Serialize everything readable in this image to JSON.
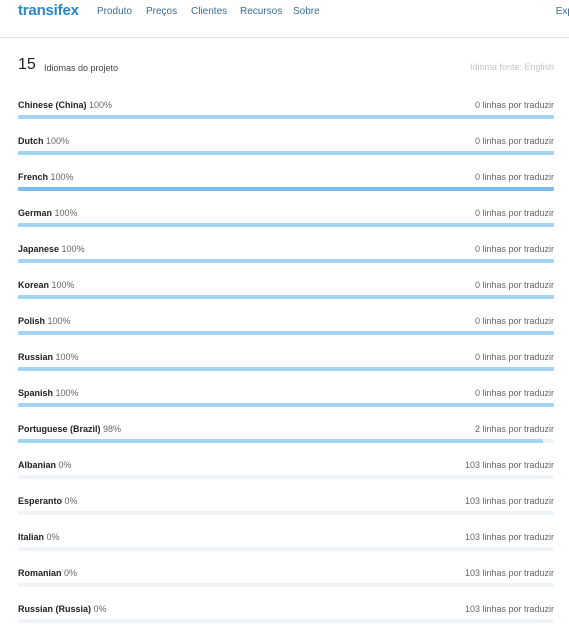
{
  "header": {
    "logo": "transifex",
    "nav": [
      "Produto",
      "Preços",
      "Clientes",
      "Recursos",
      "Sobre"
    ],
    "right_link": "Exp"
  },
  "summary": {
    "count": "15",
    "count_label": "Idiomas do projeto",
    "source_language": "Idioma fonte: English"
  },
  "languages": [
    {
      "name": "Chinese (China)",
      "percent": "100%",
      "progress": 100,
      "remaining": "0 linhas por traduzir"
    },
    {
      "name": "Dutch",
      "percent": "100%",
      "progress": 100,
      "remaining": "0 linhas por traduzir"
    },
    {
      "name": "French",
      "percent": "100%",
      "progress": 100,
      "remaining": "0 linhas por traduzir"
    },
    {
      "name": "German",
      "percent": "100%",
      "progress": 100,
      "remaining": "0 linhas por traduzir"
    },
    {
      "name": "Japanese",
      "percent": "100%",
      "progress": 100,
      "remaining": "0 linhas por traduzir"
    },
    {
      "name": "Korean",
      "percent": "100%",
      "progress": 100,
      "remaining": "0 linhas por traduzir"
    },
    {
      "name": "Polish",
      "percent": "100%",
      "progress": 100,
      "remaining": "0 linhas por traduzir"
    },
    {
      "name": "Russian",
      "percent": "100%",
      "progress": 100,
      "remaining": "0 linhas por traduzir"
    },
    {
      "name": "Spanish",
      "percent": "100%",
      "progress": 100,
      "remaining": "0 linhas por traduzir"
    },
    {
      "name": "Portuguese (Brazil)",
      "percent": "98%",
      "progress": 98,
      "remaining": "2 linhas por traduzir"
    },
    {
      "name": "Albanian",
      "percent": "0%",
      "progress": 0,
      "remaining": "103 linhas por traduzir"
    },
    {
      "name": "Esperanto",
      "percent": "0%",
      "progress": 0,
      "remaining": "103 linhas por traduzir"
    },
    {
      "name": "Italian",
      "percent": "0%",
      "progress": 0,
      "remaining": "103 linhas por traduzir"
    },
    {
      "name": "Romanian",
      "percent": "0%",
      "progress": 0,
      "remaining": "103 linhas por traduzir"
    },
    {
      "name": "Russian (Russia)",
      "percent": "0%",
      "progress": 0,
      "remaining": "103 linhas por traduzir"
    }
  ],
  "colors": {
    "brand": "#2c86c5",
    "progress_fill": "#a6d4f3",
    "progress_fill_hover": "#7cbde9",
    "progress_track": "#eef3f8"
  }
}
